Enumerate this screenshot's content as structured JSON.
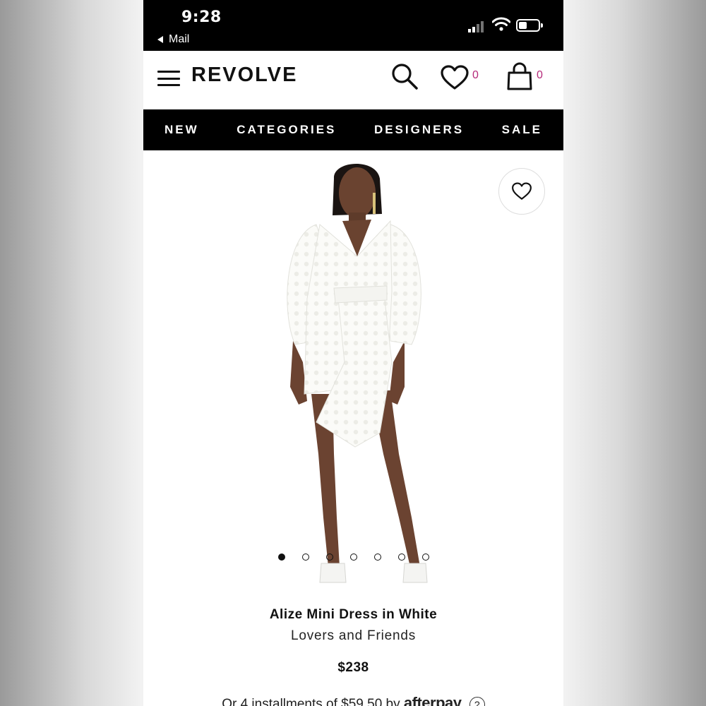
{
  "status_bar": {
    "time": "9:28",
    "back_app": "Mail"
  },
  "header": {
    "logo": "REVOLVE",
    "wishlist_count": "0",
    "bag_count": "0",
    "accent_color": "#b5297a"
  },
  "nav": {
    "items": [
      "NEW",
      "CATEGORIES",
      "DESIGNERS",
      "SALE"
    ]
  },
  "gallery": {
    "image_count": 7,
    "active_index": 0
  },
  "product": {
    "name": "Alize Mini Dress in White",
    "brand": "Lovers and Friends",
    "price": "$238",
    "installment_text": "Or 4 installments of $59.50 by",
    "installment_provider": "afterpay",
    "help_label": "?"
  }
}
